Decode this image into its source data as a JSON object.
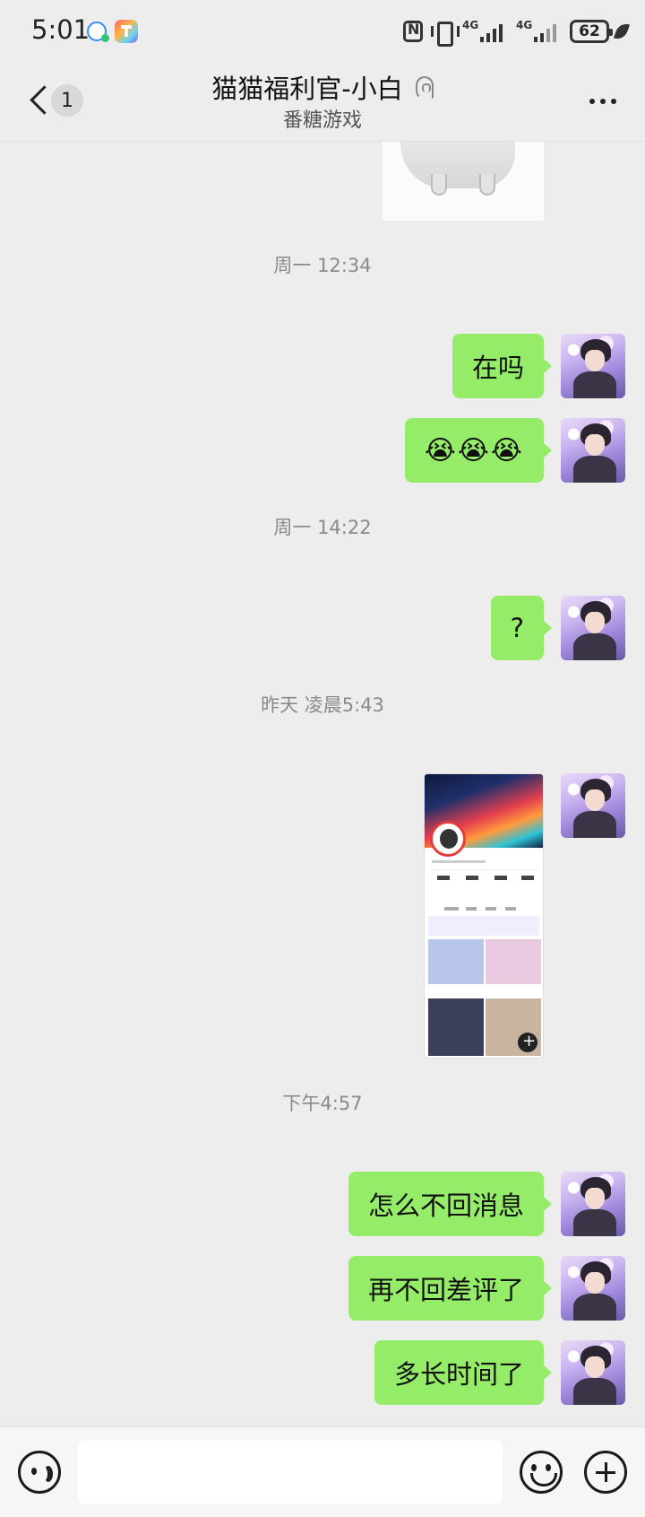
{
  "status_bar": {
    "time": "5:01",
    "signal1_label": "4G",
    "signal2_label": "4G",
    "battery": "62",
    "icons": [
      "chat-notification-icon",
      "tools-app-icon",
      "nfc-icon",
      "vibrate-icon",
      "signal-icon",
      "signal-icon",
      "battery-icon",
      "leaf-icon"
    ]
  },
  "header": {
    "back_badge": "1",
    "title": "猫猫福利官-小白",
    "subtitle": "番糖游戏",
    "icons": [
      "back-chevron-icon",
      "ear-icon",
      "more-dots-icon"
    ]
  },
  "messages": [
    {
      "type": "image",
      "alt": "cat sticker"
    },
    {
      "type": "time",
      "text": "周一 12:34"
    },
    {
      "type": "text",
      "text": "在吗"
    },
    {
      "type": "text",
      "text": "😭😭😭"
    },
    {
      "type": "time",
      "text": "周一 14:22"
    },
    {
      "type": "text",
      "text": "?"
    },
    {
      "type": "time",
      "text": "昨天 凌晨5:43"
    },
    {
      "type": "image",
      "alt": "profile screenshot"
    },
    {
      "type": "time",
      "text": "下午4:57"
    },
    {
      "type": "text",
      "text": "怎么不回消息"
    },
    {
      "type": "text",
      "text": "再不回差评了"
    },
    {
      "type": "text",
      "text": "多长时间了"
    }
  ],
  "input_bar": {
    "placeholder": "",
    "icons": [
      "voice-icon",
      "emoji-icon",
      "plus-icon"
    ]
  },
  "colors": {
    "bubble": "#95ec69",
    "background": "#ededed"
  }
}
